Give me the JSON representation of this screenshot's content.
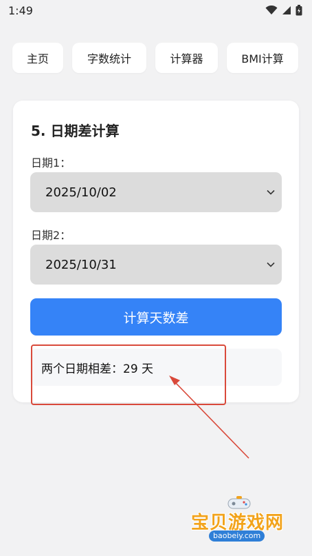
{
  "status_bar": {
    "time": "1:49",
    "icons": [
      "wifi-icon",
      "signal-icon",
      "battery-icon"
    ]
  },
  "nav": {
    "items": [
      {
        "label": "主页"
      },
      {
        "label": "字数统计"
      },
      {
        "label": "计算器"
      },
      {
        "label": "BMI计算"
      }
    ]
  },
  "card": {
    "title": "5. 日期差计算",
    "date1": {
      "label": "日期1：",
      "value": "2025/10/02"
    },
    "date2": {
      "label": "日期2：",
      "value": "2025/10/31"
    },
    "button_label": "计算天数差",
    "result": "两个日期相差：29 天"
  },
  "annotation": {
    "color": "#d9493a"
  },
  "watermark": {
    "text": "宝贝游戏网",
    "url": "baobeiy.com"
  },
  "colors": {
    "accent": "#3583f7",
    "background": "#f2f2f3",
    "select_bg": "#dcdcdc"
  }
}
